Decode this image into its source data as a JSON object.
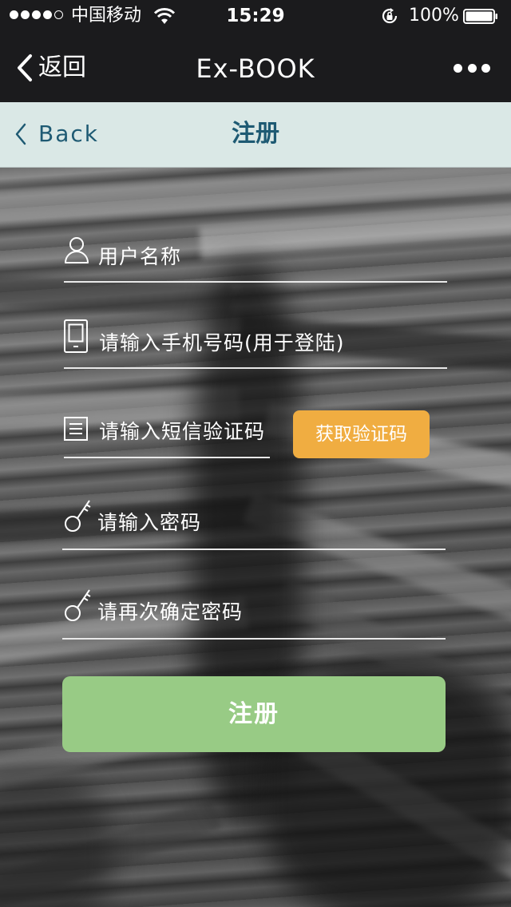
{
  "status_bar": {
    "carrier": "中国移动",
    "time": "15:29",
    "battery": "100%",
    "signal_bars_filled": 4,
    "signal_bars_total": 5
  },
  "nav": {
    "back_label": "返回",
    "title": "Ex-BOOK",
    "more_icon": "more-dots-icon"
  },
  "page_header": {
    "back_label": "Back",
    "title": "注册",
    "color": "#1e5a73",
    "background": "#dae8e6"
  },
  "form": {
    "username_placeholder": "用户名称",
    "phone_placeholder": "请输入手机号码(用于登陆)",
    "sms_code_placeholder": "请输入短信验证码",
    "get_code_label": "获取验证码",
    "password_placeholder": "请输入密码",
    "confirm_password_placeholder": "请再次确定密码",
    "submit_label": "注册"
  },
  "colors": {
    "get_code_button": "#f0ad41",
    "submit_button": "#98cb85",
    "top_bar": "#1b1b1d"
  }
}
